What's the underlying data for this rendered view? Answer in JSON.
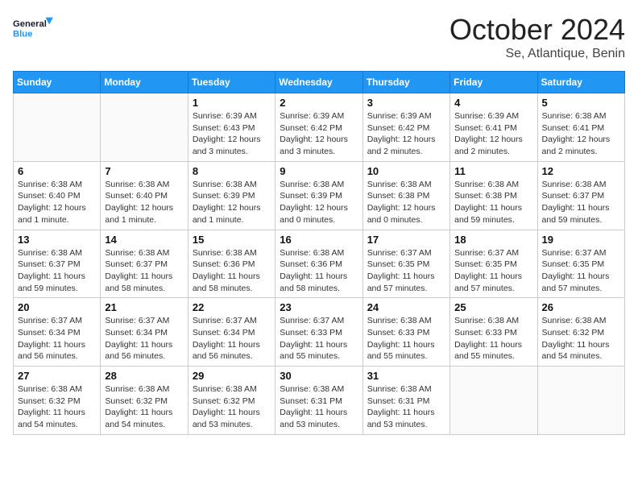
{
  "header": {
    "logo_general": "General",
    "logo_blue": "Blue",
    "month_title": "October 2024",
    "location": "Se, Atlantique, Benin"
  },
  "weekdays": [
    "Sunday",
    "Monday",
    "Tuesday",
    "Wednesday",
    "Thursday",
    "Friday",
    "Saturday"
  ],
  "weeks": [
    [
      {
        "day": "",
        "detail": ""
      },
      {
        "day": "",
        "detail": ""
      },
      {
        "day": "1",
        "detail": "Sunrise: 6:39 AM\nSunset: 6:43 PM\nDaylight: 12 hours\nand 3 minutes."
      },
      {
        "day": "2",
        "detail": "Sunrise: 6:39 AM\nSunset: 6:42 PM\nDaylight: 12 hours\nand 3 minutes."
      },
      {
        "day": "3",
        "detail": "Sunrise: 6:39 AM\nSunset: 6:42 PM\nDaylight: 12 hours\nand 2 minutes."
      },
      {
        "day": "4",
        "detail": "Sunrise: 6:39 AM\nSunset: 6:41 PM\nDaylight: 12 hours\nand 2 minutes."
      },
      {
        "day": "5",
        "detail": "Sunrise: 6:38 AM\nSunset: 6:41 PM\nDaylight: 12 hours\nand 2 minutes."
      }
    ],
    [
      {
        "day": "6",
        "detail": "Sunrise: 6:38 AM\nSunset: 6:40 PM\nDaylight: 12 hours\nand 1 minute."
      },
      {
        "day": "7",
        "detail": "Sunrise: 6:38 AM\nSunset: 6:40 PM\nDaylight: 12 hours\nand 1 minute."
      },
      {
        "day": "8",
        "detail": "Sunrise: 6:38 AM\nSunset: 6:39 PM\nDaylight: 12 hours\nand 1 minute."
      },
      {
        "day": "9",
        "detail": "Sunrise: 6:38 AM\nSunset: 6:39 PM\nDaylight: 12 hours\nand 0 minutes."
      },
      {
        "day": "10",
        "detail": "Sunrise: 6:38 AM\nSunset: 6:38 PM\nDaylight: 12 hours\nand 0 minutes."
      },
      {
        "day": "11",
        "detail": "Sunrise: 6:38 AM\nSunset: 6:38 PM\nDaylight: 11 hours\nand 59 minutes."
      },
      {
        "day": "12",
        "detail": "Sunrise: 6:38 AM\nSunset: 6:37 PM\nDaylight: 11 hours\nand 59 minutes."
      }
    ],
    [
      {
        "day": "13",
        "detail": "Sunrise: 6:38 AM\nSunset: 6:37 PM\nDaylight: 11 hours\nand 59 minutes."
      },
      {
        "day": "14",
        "detail": "Sunrise: 6:38 AM\nSunset: 6:37 PM\nDaylight: 11 hours\nand 58 minutes."
      },
      {
        "day": "15",
        "detail": "Sunrise: 6:38 AM\nSunset: 6:36 PM\nDaylight: 11 hours\nand 58 minutes."
      },
      {
        "day": "16",
        "detail": "Sunrise: 6:38 AM\nSunset: 6:36 PM\nDaylight: 11 hours\nand 58 minutes."
      },
      {
        "day": "17",
        "detail": "Sunrise: 6:37 AM\nSunset: 6:35 PM\nDaylight: 11 hours\nand 57 minutes."
      },
      {
        "day": "18",
        "detail": "Sunrise: 6:37 AM\nSunset: 6:35 PM\nDaylight: 11 hours\nand 57 minutes."
      },
      {
        "day": "19",
        "detail": "Sunrise: 6:37 AM\nSunset: 6:35 PM\nDaylight: 11 hours\nand 57 minutes."
      }
    ],
    [
      {
        "day": "20",
        "detail": "Sunrise: 6:37 AM\nSunset: 6:34 PM\nDaylight: 11 hours\nand 56 minutes."
      },
      {
        "day": "21",
        "detail": "Sunrise: 6:37 AM\nSunset: 6:34 PM\nDaylight: 11 hours\nand 56 minutes."
      },
      {
        "day": "22",
        "detail": "Sunrise: 6:37 AM\nSunset: 6:34 PM\nDaylight: 11 hours\nand 56 minutes."
      },
      {
        "day": "23",
        "detail": "Sunrise: 6:37 AM\nSunset: 6:33 PM\nDaylight: 11 hours\nand 55 minutes."
      },
      {
        "day": "24",
        "detail": "Sunrise: 6:38 AM\nSunset: 6:33 PM\nDaylight: 11 hours\nand 55 minutes."
      },
      {
        "day": "25",
        "detail": "Sunrise: 6:38 AM\nSunset: 6:33 PM\nDaylight: 11 hours\nand 55 minutes."
      },
      {
        "day": "26",
        "detail": "Sunrise: 6:38 AM\nSunset: 6:32 PM\nDaylight: 11 hours\nand 54 minutes."
      }
    ],
    [
      {
        "day": "27",
        "detail": "Sunrise: 6:38 AM\nSunset: 6:32 PM\nDaylight: 11 hours\nand 54 minutes."
      },
      {
        "day": "28",
        "detail": "Sunrise: 6:38 AM\nSunset: 6:32 PM\nDaylight: 11 hours\nand 54 minutes."
      },
      {
        "day": "29",
        "detail": "Sunrise: 6:38 AM\nSunset: 6:32 PM\nDaylight: 11 hours\nand 53 minutes."
      },
      {
        "day": "30",
        "detail": "Sunrise: 6:38 AM\nSunset: 6:31 PM\nDaylight: 11 hours\nand 53 minutes."
      },
      {
        "day": "31",
        "detail": "Sunrise: 6:38 AM\nSunset: 6:31 PM\nDaylight: 11 hours\nand 53 minutes."
      },
      {
        "day": "",
        "detail": ""
      },
      {
        "day": "",
        "detail": ""
      }
    ]
  ]
}
